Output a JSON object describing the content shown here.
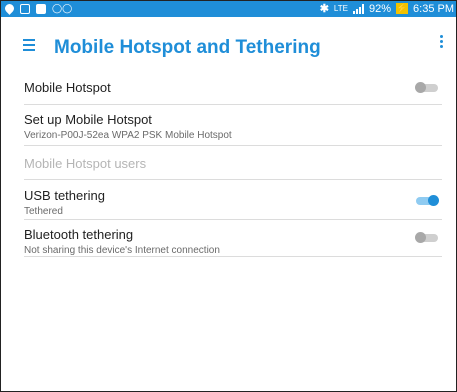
{
  "status_bar": {
    "signal_text": "LTE",
    "battery_percent": "92%",
    "time": "6:35 PM",
    "icons": [
      "location-icon",
      "notification-icon",
      "image-icon",
      "voicemail-icon",
      "bluetooth-icon",
      "signal-icon",
      "battery-charging-icon"
    ]
  },
  "app_bar": {
    "title": "Mobile Hotspot and Tethering",
    "menu_icon": "hamburger-menu-icon",
    "more_icon": "more-options-icon",
    "accent_color": "#1f8ed8"
  },
  "settings": [
    {
      "id": "mobile-hotspot",
      "label": "Mobile Hotspot",
      "subtitle": "",
      "toggle": true,
      "on": false,
      "enabled": true
    },
    {
      "id": "setup-mobile-hotspot",
      "label": "Set up Mobile Hotspot",
      "subtitle": "Verizon-P00J-52ea WPA2 PSK Mobile Hotspot",
      "toggle": false,
      "enabled": true
    },
    {
      "id": "mobile-hotspot-users",
      "label": "Mobile Hotspot users",
      "subtitle": "",
      "toggle": false,
      "enabled": false
    },
    {
      "id": "usb-tethering",
      "label": "USB tethering",
      "subtitle": "Tethered",
      "toggle": true,
      "on": true,
      "enabled": true
    },
    {
      "id": "bluetooth-tethering",
      "label": "Bluetooth tethering",
      "subtitle": "Not sharing this device's Internet connection",
      "toggle": true,
      "on": false,
      "enabled": true
    }
  ]
}
